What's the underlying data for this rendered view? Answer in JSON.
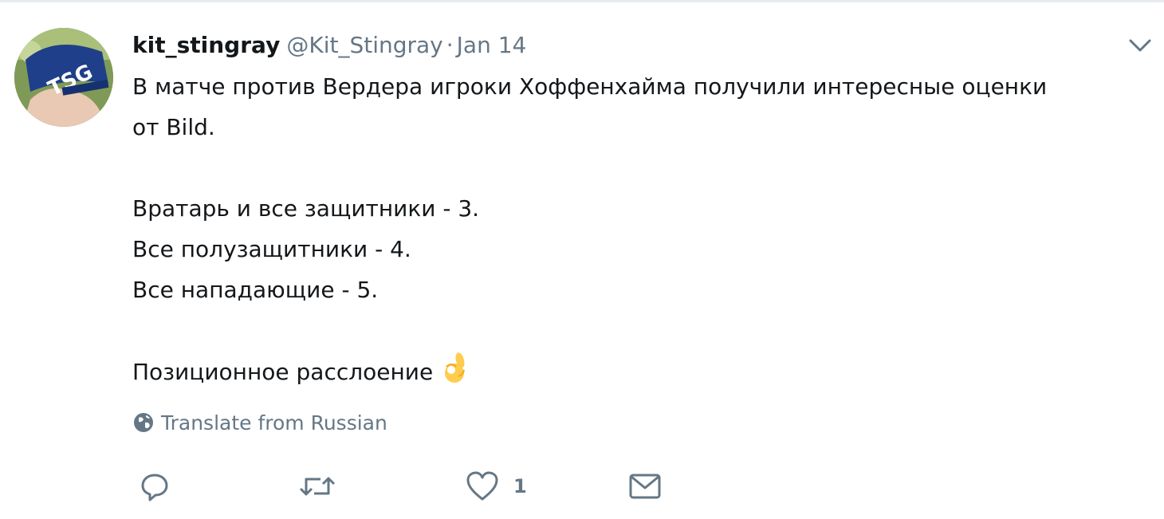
{
  "tweet": {
    "display_name": "kit_stingray",
    "handle": "@Kit_Stingray",
    "separator": "·",
    "timestamp": "Jan 14",
    "text_lines": {
      "line1": "В матче против Вердера игроки Хоффенхайма получили интересные оценки",
      "line2": "от Bild.",
      "line3": "Вратарь и все защитники - 3.",
      "line4": "Все полузащитники - 4.",
      "line5": "Все нападающие - 5.",
      "line6": "Позиционное расслоение"
    },
    "emoji": "ok-hand-emoji",
    "avatar_cap_text": "TSG",
    "translate_label": "Translate from Russian",
    "like_count": "1"
  },
  "icons": {
    "caret": "chevron-down-icon",
    "globe": "globe-icon",
    "reply": "reply-icon",
    "retweet": "retweet-icon",
    "like": "heart-icon",
    "message": "envelope-icon"
  },
  "colors": {
    "text_primary": "#14171a",
    "text_secondary": "#657786",
    "divider": "#e6ecf0",
    "emoji_yellow": "#ffcc4d"
  }
}
